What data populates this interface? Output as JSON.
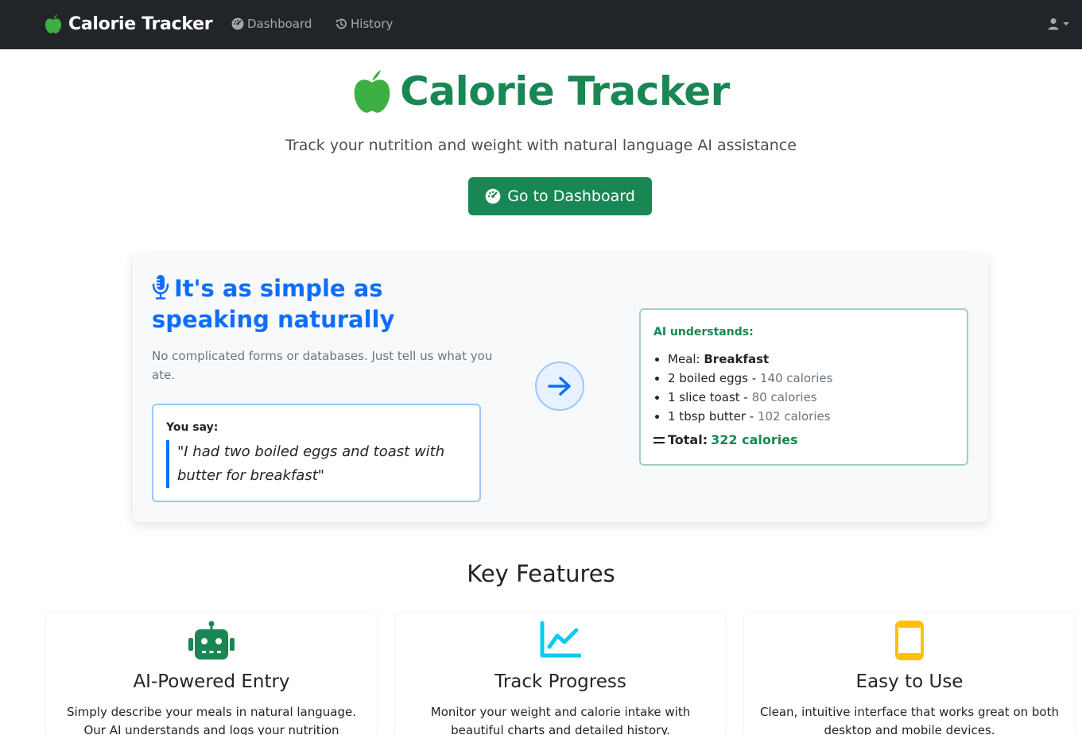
{
  "navbar": {
    "brand": "Calorie Tracker",
    "links": [
      {
        "label": "Dashboard",
        "icon": "tachometer-icon"
      },
      {
        "label": "History",
        "icon": "history-icon"
      }
    ],
    "user_icon": "user-icon"
  },
  "hero": {
    "title": "Calorie Tracker",
    "subtitle": "Track your nutrition and weight with natural language AI assistance",
    "button_label": "Go to Dashboard"
  },
  "demo": {
    "heading": "It's as simple as speaking naturally",
    "description": "No complicated forms or databases. Just tell us what you ate.",
    "you_say_label": "You say:",
    "quote": "\"I had two boiled eggs and toast with butter for breakfast\"",
    "ai_label": "AI understands:",
    "meal_label": "Meal:",
    "meal_value": "Breakfast",
    "items": [
      {
        "name": "2 boiled eggs",
        "sep": " - ",
        "calories": "140 calories"
      },
      {
        "name": "1 slice toast",
        "sep": " - ",
        "calories": "80 calories"
      },
      {
        "name": "1 tbsp butter",
        "sep": " - ",
        "calories": "102 calories"
      }
    ],
    "total_label": "Total:",
    "total_value": "322 calories"
  },
  "features": {
    "title": "Key Features",
    "items": [
      {
        "title": "AI-Powered Entry",
        "desc": "Simply describe your meals in natural language. Our AI understands and logs your nutrition automatically.",
        "icon": "robot-icon",
        "color": "#198754"
      },
      {
        "title": "Track Progress",
        "desc": "Monitor your weight and calorie intake with beautiful charts and detailed history.",
        "icon": "chart-line-icon",
        "color": "#0dcaf0"
      },
      {
        "title": "Easy to Use",
        "desc": "Clean, intuitive interface that works great on both desktop and mobile devices.",
        "icon": "mobile-icon",
        "color": "#ffc107"
      }
    ]
  },
  "colors": {
    "primary": "#0d6efd",
    "success": "#198754",
    "dark": "#212529"
  }
}
